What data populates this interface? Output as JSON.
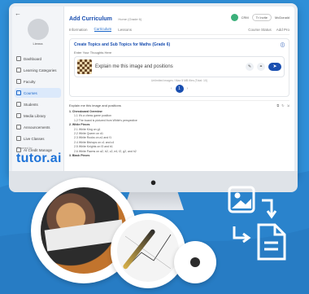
{
  "header": {
    "title": "Add Curriculum",
    "subtitle": "Home (Grade 6)",
    "right_items": [
      "CRM",
      "Tr Invite",
      "McDonald"
    ]
  },
  "sidebar": {
    "username": "Lienna",
    "items": [
      {
        "label": "Dashboard",
        "active": false
      },
      {
        "label": "Learning Categories",
        "active": false
      },
      {
        "label": "Faculty",
        "active": false
      },
      {
        "label": "Courses",
        "active": true
      },
      {
        "label": "Students",
        "active": false
      },
      {
        "label": "Media Library",
        "active": false
      },
      {
        "label": "Announcements",
        "active": false
      },
      {
        "label": "Live Classes",
        "active": false
      },
      {
        "label": "AI Credit Manage",
        "active": false
      }
    ],
    "powered_by": "Powered by",
    "brand": "tutor.ai"
  },
  "tabs": {
    "items": [
      "Information",
      "Curriculum",
      "Lessons"
    ],
    "active": "Curriculum",
    "right": [
      "Course Status",
      "Add Pro"
    ]
  },
  "card": {
    "title": "Create Topics and Sub Topics for Maths (Grade 6)",
    "input_label": "Enter Your Thoughts Here",
    "prompt_text": "Explain me this image and positions",
    "helper": "Unlimited images / Max 5 MB files (Total: 10)",
    "send_label": "➤",
    "page_number": "1"
  },
  "result": {
    "heading": "Explain me this image and positions",
    "lines": [
      {
        "text": "1. Chessboard Overview",
        "bold": true
      },
      {
        "text": "1.1 It's a chess game position",
        "bold": false
      },
      {
        "text": "1.2 The board is pictured from White's perspective",
        "bold": false
      },
      {
        "text": "2. White Pieces",
        "bold": true
      },
      {
        "text": "2.1 White King on g1",
        "bold": false
      },
      {
        "text": "2.2 White Queen on d1",
        "bold": false
      },
      {
        "text": "2.3 White Rooks on a1 and f1",
        "bold": false
      },
      {
        "text": "2.4 White Bishops on c1 and c4",
        "bold": false
      },
      {
        "text": "2.5 White Knights on f3 and b1",
        "bold": false
      },
      {
        "text": "2.6 White Pawns on a2, b2, c2, e4, f2, g2, and h2",
        "bold": false
      },
      {
        "text": "3. Black Pieces",
        "bold": true
      }
    ]
  },
  "chin_logo": "",
  "colors": {
    "background": "#2f8fd8",
    "accent": "#1a4fb0",
    "brand": "#1e73d8"
  }
}
